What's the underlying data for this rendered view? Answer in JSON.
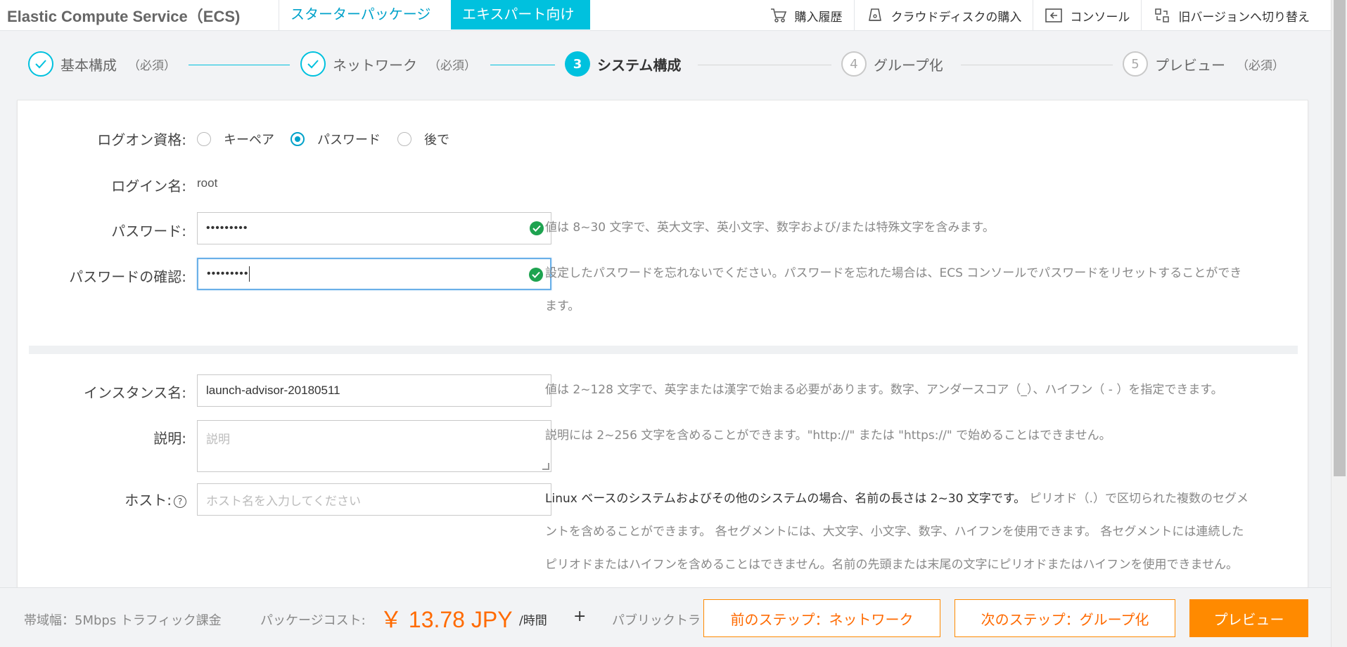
{
  "header": {
    "brand": "Elastic Compute Service（ECS)",
    "tabs": [
      {
        "label": "スターターパッケージ"
      },
      {
        "label": "エキスパート向け"
      }
    ],
    "links": [
      {
        "label": "購入履歴",
        "icon": "cart-icon"
      },
      {
        "label": "クラウドディスクの購入",
        "icon": "disk-icon"
      },
      {
        "label": "コンソール",
        "icon": "console-icon"
      },
      {
        "label": "旧バージョンへ切り替え",
        "icon": "switch-icon"
      }
    ]
  },
  "steps": [
    {
      "num": "1",
      "label": "基本構成",
      "required": "（必須）",
      "state": "done"
    },
    {
      "num": "2",
      "label": "ネットワーク",
      "required": "（必須）",
      "state": "done"
    },
    {
      "num": "3",
      "label": "システム構成",
      "required": "",
      "state": "active"
    },
    {
      "num": "4",
      "label": "グループ化",
      "required": "",
      "state": "todo"
    },
    {
      "num": "5",
      "label": "プレビュー",
      "required": "（必須）",
      "state": "todo"
    }
  ],
  "form": {
    "logon_label": "ログオン資格:",
    "logon_options": [
      {
        "label": "キーペア",
        "checked": false
      },
      {
        "label": "パスワード",
        "checked": true
      },
      {
        "label": "後で",
        "checked": false
      }
    ],
    "login_name_label": "ログイン名:",
    "login_name_value": "root",
    "password_label": "パスワード:",
    "password_value": "•••••••••",
    "password_hint": "値は 8~30 文字で、英大文字、英小文字、数字および/または特殊文字を含みます。",
    "confirm_label": "パスワードの確認:",
    "confirm_value": "•••••••••",
    "confirm_hint_1": "設定したパスワードを忘れないでください。パスワードを忘れた場合は、ECS コンソールでパスワードをリセットすることができ",
    "confirm_hint_2": "ます。",
    "instance_label": "インスタンス名:",
    "instance_value": "launch-advisor-20180511",
    "instance_hint": "値は 2~128 文字で、英字または漢字で始まる必要があります。数字、アンダースコア（_）、ハイフン（ - ）を指定できます。",
    "desc_label": "説明:",
    "desc_placeholder": "説明",
    "desc_hint": "説明には 2~256 文字を含めることができます。\"http://\" または \"https://\" で始めることはできません。",
    "host_label": "ホスト:",
    "host_help": "?",
    "host_placeholder": "ホスト名を入力してください",
    "host_hint_1_dark": "Linux ベースのシステムおよびその他のシステムの場合、名前の長さは 2~30 文字です。",
    "host_hint_1_light": " ピリオド（.）で区切られた複数のセグメ",
    "host_hint_2": "ントを含めることができます。 各セグメントには、大文字、小文字、数字、ハイフンを使用できます。 各セグメントには連続した",
    "host_hint_3": "ピリオドまたはハイフンを含めることはできません。名前の先頭または末尾の文字にピリオドまたはハイフンを使用できません。"
  },
  "footer": {
    "bandwidth": "帯域幅：5Mbps トラフィック課金",
    "package_cost_label": "パッケージコスト:",
    "price": "￥ 13.78 JPY",
    "per_hour": "/時間",
    "plus": "+",
    "public_traffic": "パブリックトラ",
    "prev_button": "前のステップ：ネットワーク",
    "next_button": "次のステップ：グループ化",
    "preview_button": "プレビュー"
  },
  "colors": {
    "accent": "#00c1de",
    "orange": "#ff8a00",
    "success": "#1ea350"
  }
}
